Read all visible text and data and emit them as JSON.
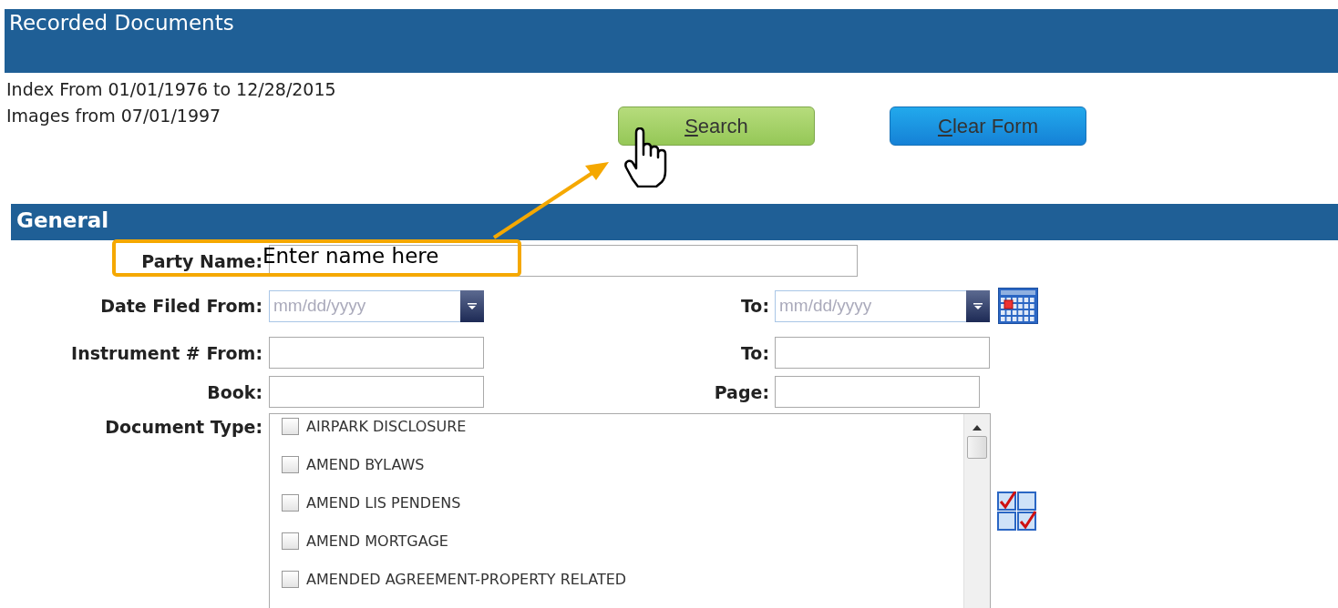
{
  "header": {
    "title": "Recorded Documents"
  },
  "info": [
    "Index From 01/01/1976 to 12/28/2015",
    "Images from 07/01/1997"
  ],
  "buttons": [
    {
      "label": "Search",
      "kind": "search"
    },
    {
      "label": "Clear Form",
      "kind": "clear"
    }
  ],
  "section": {
    "title": "General"
  },
  "form": {
    "party_name": {
      "label": "Party Name:"
    },
    "date_filed": {
      "label": "Date Filed From:",
      "from_placeholder": "mm/dd/yyyy",
      "to_label": "To:",
      "to_placeholder": "mm/dd/yyyy"
    },
    "instrument": {
      "label": "Instrument # From:",
      "to_label": "To:"
    },
    "book": {
      "label": "Book:"
    },
    "page": {
      "label": "Page:"
    },
    "document_type": {
      "label": "Document Type:",
      "options": [
        {
          "label": "AIRPARK DISCLOSURE",
          "checked": false
        },
        {
          "label": "AMEND BYLAWS",
          "checked": false
        },
        {
          "label": "AMEND LIS PENDENS",
          "checked": false
        },
        {
          "label": "AMEND MORTGAGE",
          "checked": false
        },
        {
          "label": "AMENDED AGREEMENT-PROPERTY RELATED",
          "checked": false
        }
      ]
    }
  },
  "annotation": {
    "callout": "Enter name here"
  }
}
